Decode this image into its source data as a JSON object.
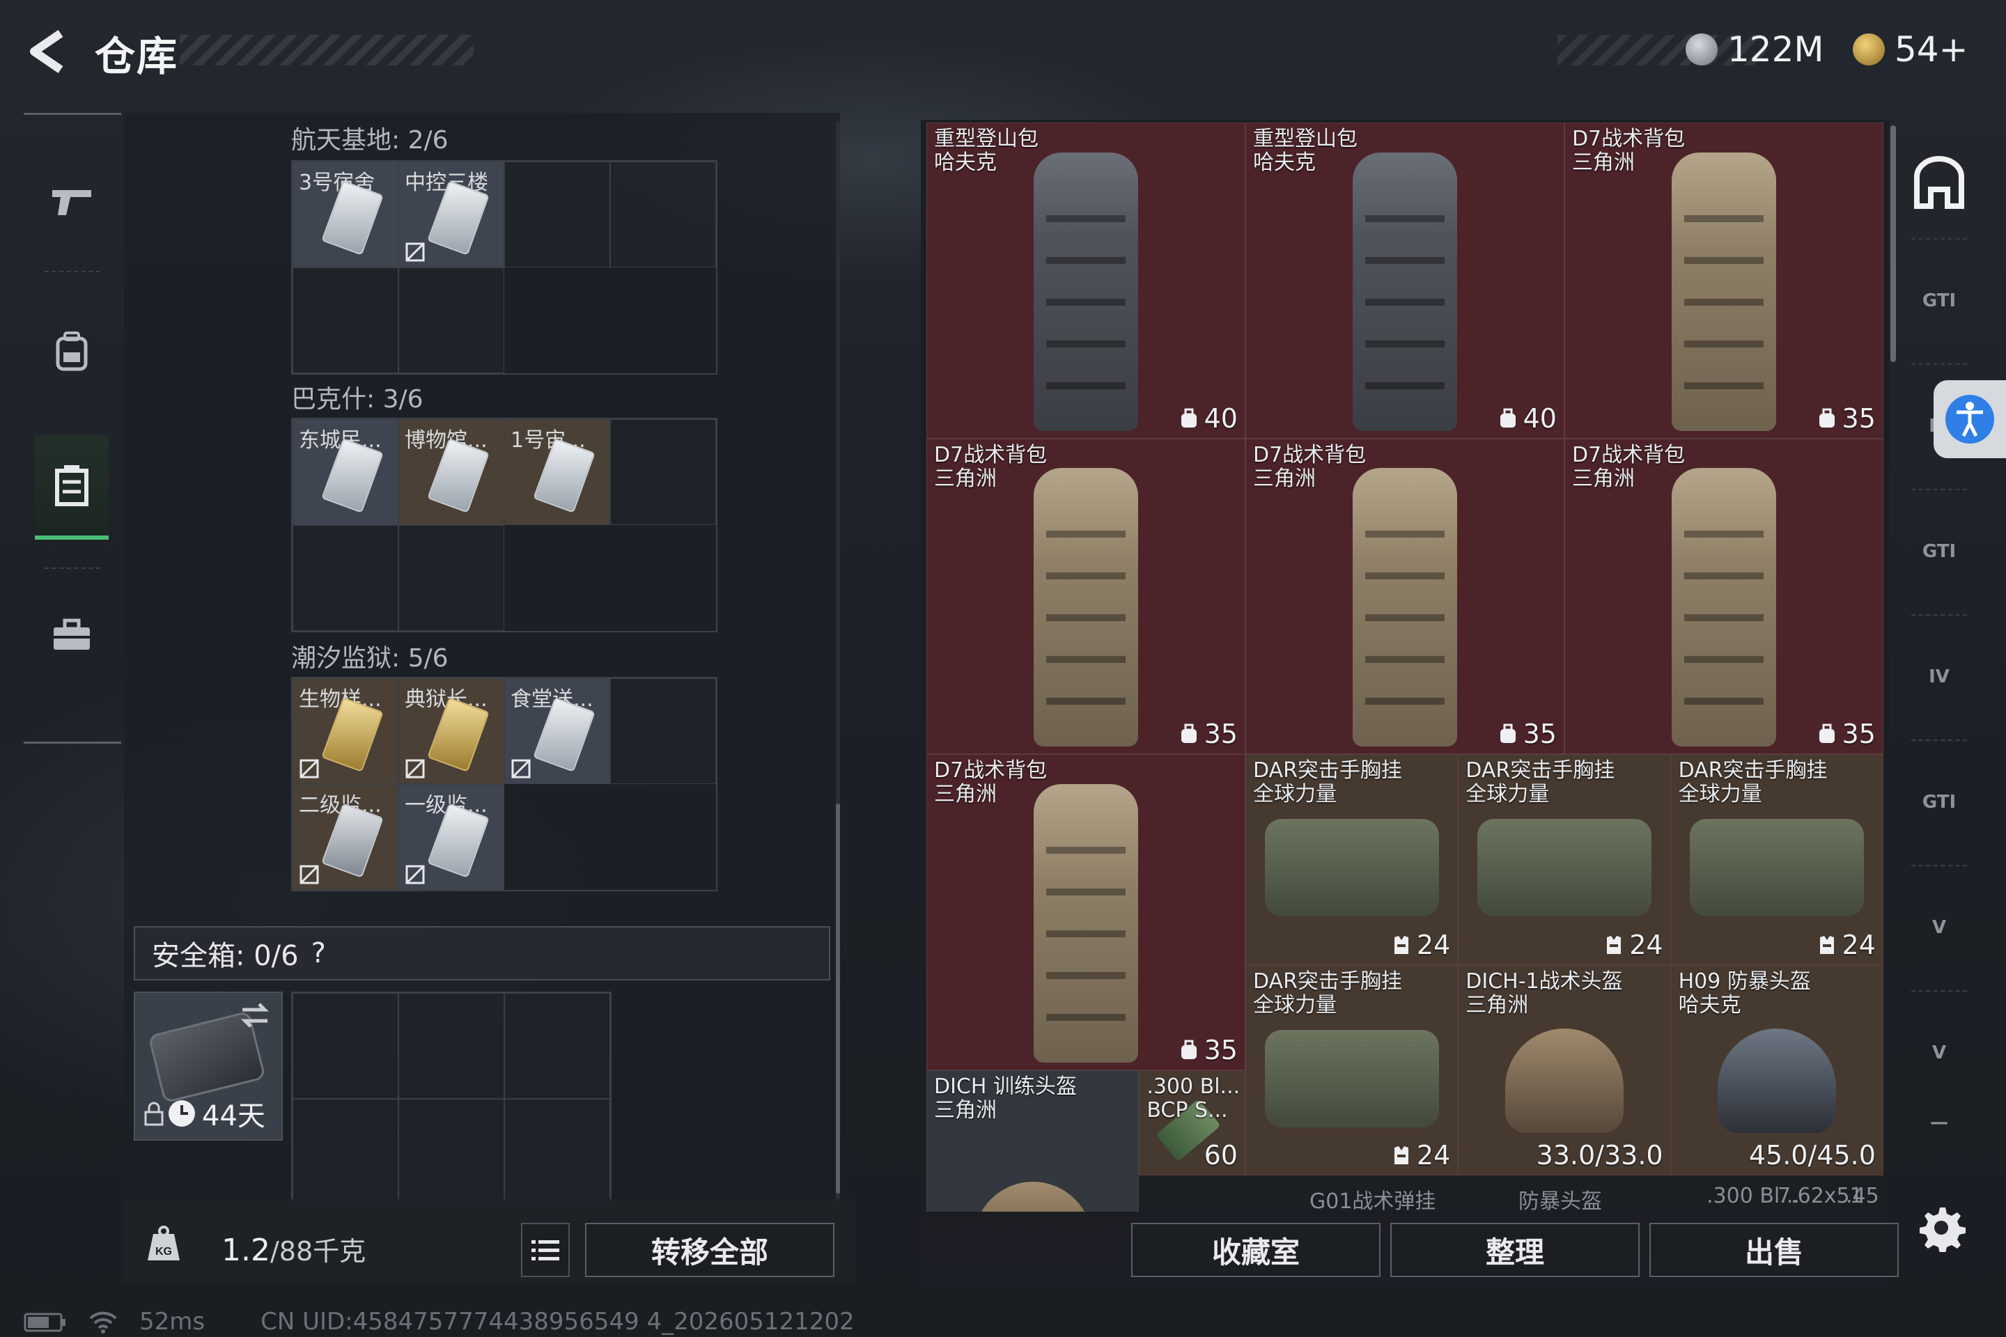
{
  "header": {
    "title": "仓库",
    "currency1": {
      "icon": "silver-coin-icon",
      "value": "122M"
    },
    "currency2": {
      "icon": "gold-coin-icon",
      "value": "54+"
    }
  },
  "left_rail": {
    "items": [
      {
        "name": "weapons-tab",
        "icon": "gun-icon"
      },
      {
        "name": "equipment-tab",
        "icon": "backpack-icon"
      },
      {
        "name": "storage-tab",
        "icon": "crate-icon",
        "active": true
      },
      {
        "name": "case-tab",
        "icon": "briefcase-icon"
      }
    ]
  },
  "keys": {
    "sections": [
      {
        "label": "航天基地: 2/6",
        "items": [
          "3号宿舍",
          "中控三楼"
        ]
      },
      {
        "label": "巴克什: 3/6",
        "items": [
          "东城民...",
          "博物馆...",
          "1号宙..."
        ]
      },
      {
        "label": "潮汐监狱: 5/6",
        "items": [
          "生物样...",
          "典狱长...",
          "食堂送...",
          "二级监...",
          "一级监..."
        ]
      }
    ]
  },
  "safebox": {
    "label": "安全箱: 0/6",
    "help": "?",
    "duration": "44天"
  },
  "bottom_left": {
    "weight": "1.2",
    "weight_max": "/88千克",
    "transfer_all": "转移全部"
  },
  "storage": {
    "items": [
      {
        "name": "重型登山包",
        "sub": "哈夫克",
        "value": "40",
        "type": "backpack"
      },
      {
        "name": "重型登山包",
        "sub": "哈夫克",
        "value": "40",
        "type": "backpack"
      },
      {
        "name": "D7战术背包",
        "sub": "三角洲",
        "value": "35",
        "type": "backpack"
      },
      {
        "name": "D7战术背包",
        "sub": "三角洲",
        "value": "35",
        "type": "backpack"
      },
      {
        "name": "D7战术背包",
        "sub": "三角洲",
        "value": "35",
        "type": "backpack"
      },
      {
        "name": "D7战术背包",
        "sub": "三角洲",
        "value": "35",
        "type": "backpack"
      },
      {
        "name": "D7战术背包",
        "sub": "三角洲",
        "value": "35",
        "type": "backpack"
      },
      {
        "name": "DAR突击手胸挂",
        "sub": "全球力量",
        "value": "24",
        "type": "vest"
      },
      {
        "name": "DAR突击手胸挂",
        "sub": "全球力量",
        "value": "24",
        "type": "vest"
      },
      {
        "name": "DAR突击手胸挂",
        "sub": "全球力量",
        "value": "24",
        "type": "vest"
      },
      {
        "name": "DAR突击手胸挂",
        "sub": "全球力量",
        "value": "24",
        "type": "vest"
      },
      {
        "name": "DICH-1战术头盔",
        "sub": "三角洲",
        "value": "33.0/33.0",
        "type": "helmet"
      },
      {
        "name": "H09 防暴头盔",
        "sub": "哈夫克",
        "value": "45.0/45.0",
        "type": "helmet"
      },
      {
        "name": "DICH 训练头盔",
        "sub": "三角洲",
        "value": "",
        "type": "helmet"
      },
      {
        "name": ".300 Bl...",
        "sub": "BCP S...",
        "value": "60",
        "type": "ammo"
      }
    ],
    "bottom_row": [
      "G01战术弹挂",
      "防暴头盔",
      ".300 Bl...",
      ".45",
      "7.62x51"
    ]
  },
  "bottom_right": {
    "collection": "收藏室",
    "sort": "整理",
    "sell": "出售"
  },
  "right_rail": {
    "items": [
      "GTI",
      "IV",
      "GTI",
      "IV",
      "GTI",
      "V",
      "V",
      "—"
    ]
  },
  "status": {
    "ping": "52ms",
    "uid": "CN UID:4584757774438956549 4_202605121202"
  },
  "colors": {
    "accent": "#49c079",
    "red_slot": "#4c2328",
    "brown_slot": "#46392f"
  }
}
